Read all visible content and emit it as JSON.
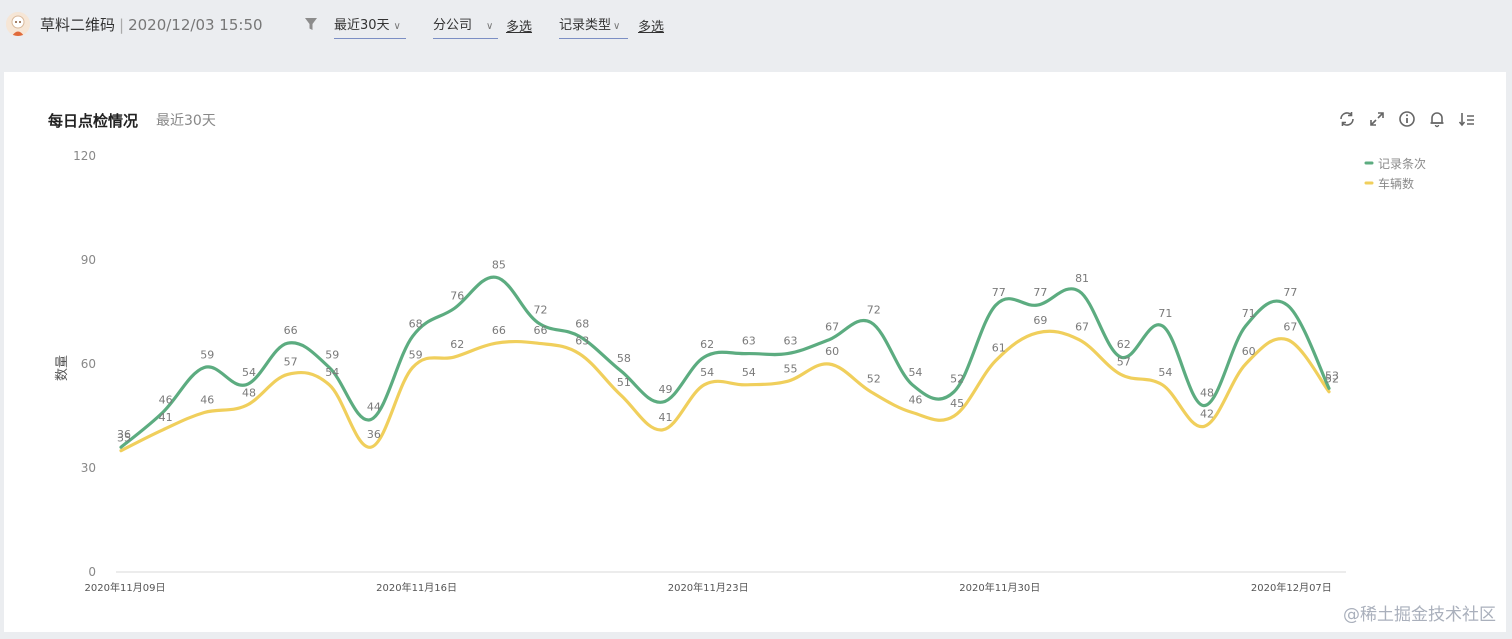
{
  "header": {
    "app_name": "草料二维码",
    "separator": "|",
    "timestamp": "2020/12/03 15:50",
    "filters": [
      {
        "label": "最近30天",
        "has_multi": false
      },
      {
        "label": "分公司",
        "has_multi": true,
        "multi_label": "多选"
      },
      {
        "label": "记录类型",
        "has_multi": true,
        "multi_label": "多选"
      }
    ]
  },
  "card": {
    "title": "每日点检情况",
    "subtitle": "最近30天",
    "tools": [
      "refresh-icon",
      "expand-icon",
      "info-icon",
      "bell-icon",
      "sort-icon"
    ]
  },
  "watermark": "@稀土掘金技术社区",
  "chart_data": {
    "type": "line",
    "ylabel": "数量",
    "xlabel": "",
    "ylim": [
      0,
      120
    ],
    "yticks": [
      0,
      30,
      60,
      90,
      120
    ],
    "grid": false,
    "legend_position": "top-right",
    "x": [
      "2020年11月09日",
      "2020年11月10日",
      "2020年11月11日",
      "2020年11月12日",
      "2020年11月13日",
      "2020年11月14日",
      "2020年11月15日",
      "2020年11月16日",
      "2020年11月17日",
      "2020年11月18日",
      "2020年11月19日",
      "2020年11月20日",
      "2020年11月21日",
      "2020年11月22日",
      "2020年11月23日",
      "2020年11月24日",
      "2020年11月25日",
      "2020年11月26日",
      "2020年11月27日",
      "2020年11月28日",
      "2020年11月29日",
      "2020年11月30日",
      "2020年12月01日",
      "2020年12月02日",
      "2020年12月03日",
      "2020年12月04日",
      "2020年12月05日",
      "2020年12月06日",
      "2020年12月07日",
      "2020年12月08日"
    ],
    "x_tick_labels": [
      "2020年11月09日",
      "2020年11月16日",
      "2020年11月23日",
      "2020年11月30日",
      "2020年12月07日"
    ],
    "series": [
      {
        "name": "记录条次",
        "color": "#5cac80",
        "values": [
          36,
          46,
          59,
          54,
          66,
          59,
          44,
          68,
          76,
          85,
          72,
          68,
          58,
          49,
          62,
          63,
          63,
          67,
          72,
          54,
          52,
          77,
          77,
          81,
          62,
          71,
          48,
          71,
          77,
          53
        ]
      },
      {
        "name": "车辆数",
        "color": "#f0cf5c",
        "values": [
          35,
          41,
          46,
          48,
          57,
          54,
          36,
          59,
          62,
          66,
          66,
          63,
          51,
          41,
          54,
          54,
          55,
          60,
          52,
          46,
          45,
          61,
          69,
          67,
          57,
          54,
          42,
          60,
          67,
          52
        ]
      }
    ]
  }
}
